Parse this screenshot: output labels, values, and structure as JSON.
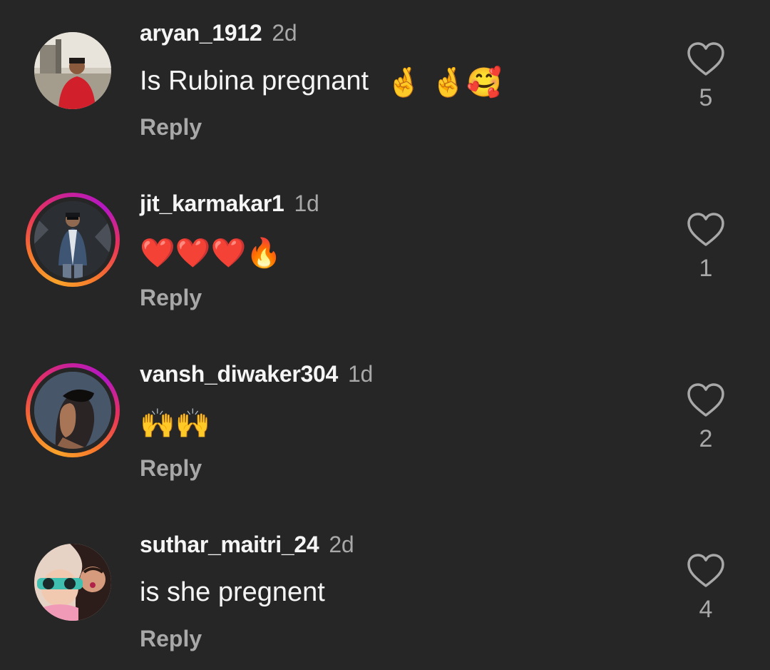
{
  "comments": [
    {
      "username": "aryan_1912",
      "time": "2d",
      "text": "Is Rubina pregnant",
      "emojis": "🤞 🤞🥰",
      "reply_label": "Reply",
      "likes": "5",
      "has_story": false
    },
    {
      "username": "jit_karmakar1",
      "time": "1d",
      "text": "",
      "emojis": "❤️❤️❤️🔥",
      "reply_label": "Reply",
      "likes": "1",
      "has_story": true
    },
    {
      "username": "vansh_diwaker304",
      "time": "1d",
      "text": "",
      "emojis": "🙌🙌",
      "reply_label": "Reply",
      "likes": "2",
      "has_story": true
    },
    {
      "username": "suthar_maitri_24",
      "time": "2d",
      "text": "is she pregnent",
      "emojis": "",
      "reply_label": "Reply",
      "likes": "4",
      "has_story": false
    }
  ],
  "colors": {
    "background": "#262626",
    "primary_text": "#f5f5f5",
    "secondary_text": "#a8a8a8",
    "story_ring_start": "#f9a22a",
    "story_ring_end": "#c7219a"
  },
  "icons": {
    "like": "heart-outline-icon"
  }
}
